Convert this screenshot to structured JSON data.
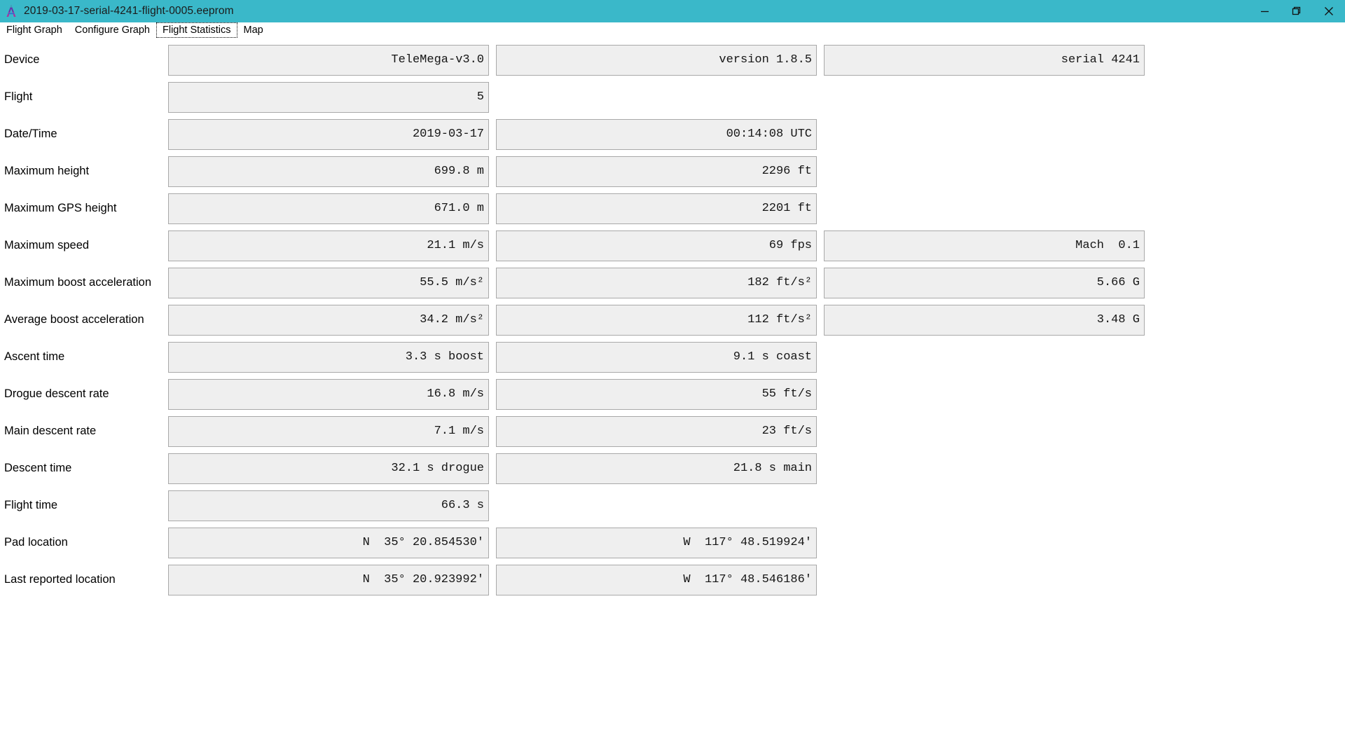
{
  "window": {
    "title": "2019-03-17-serial-4241-flight-0005.eeprom",
    "app_icon": "altos-logo-icon",
    "accent_color": "#3ab8c9",
    "controls": {
      "minimize": "minimize-icon",
      "restore": "restore-icon",
      "close": "close-icon"
    }
  },
  "tabs": [
    {
      "label": "Flight Graph",
      "selected": false
    },
    {
      "label": "Configure Graph",
      "selected": false
    },
    {
      "label": "Flight Statistics",
      "selected": true
    },
    {
      "label": "Map",
      "selected": false
    }
  ],
  "stats": {
    "rows": [
      {
        "label": "Device",
        "values": [
          "TeleMega-v3.0",
          "version 1.8.5",
          "serial 4241"
        ]
      },
      {
        "label": "Flight",
        "values": [
          "5",
          "",
          ""
        ]
      },
      {
        "label": "Date/Time",
        "values": [
          "2019-03-17",
          "00:14:08 UTC",
          ""
        ]
      },
      {
        "label": "Maximum height",
        "values": [
          "699.8 m",
          "2296 ft",
          ""
        ]
      },
      {
        "label": "Maximum GPS height",
        "values": [
          "671.0 m",
          "2201 ft",
          ""
        ]
      },
      {
        "label": "Maximum speed",
        "values": [
          "21.1 m/s",
          "69 fps",
          "Mach  0.1"
        ]
      },
      {
        "label": "Maximum boost acceleration",
        "values": [
          "55.5 m/s²",
          "182 ft/s²",
          "5.66 G"
        ]
      },
      {
        "label": "Average boost acceleration",
        "values": [
          "34.2 m/s²",
          "112 ft/s²",
          "3.48 G"
        ]
      },
      {
        "label": "Ascent time",
        "values": [
          "3.3 s boost",
          "9.1 s coast",
          ""
        ]
      },
      {
        "label": "Drogue descent rate",
        "values": [
          "16.8 m/s",
          "55 ft/s",
          ""
        ]
      },
      {
        "label": "Main descent rate",
        "values": [
          "7.1 m/s",
          "23 ft/s",
          ""
        ]
      },
      {
        "label": "Descent time",
        "values": [
          "32.1 s drogue",
          "21.8 s main",
          ""
        ]
      },
      {
        "label": "Flight time",
        "values": [
          "66.3 s",
          "",
          ""
        ]
      },
      {
        "label": "Pad location",
        "values": [
          "N  35° 20.854530'",
          "W  117° 48.519924'",
          ""
        ]
      },
      {
        "label": "Last reported location",
        "values": [
          "N  35° 20.923992'",
          "W  117° 48.546186'",
          ""
        ]
      }
    ]
  }
}
